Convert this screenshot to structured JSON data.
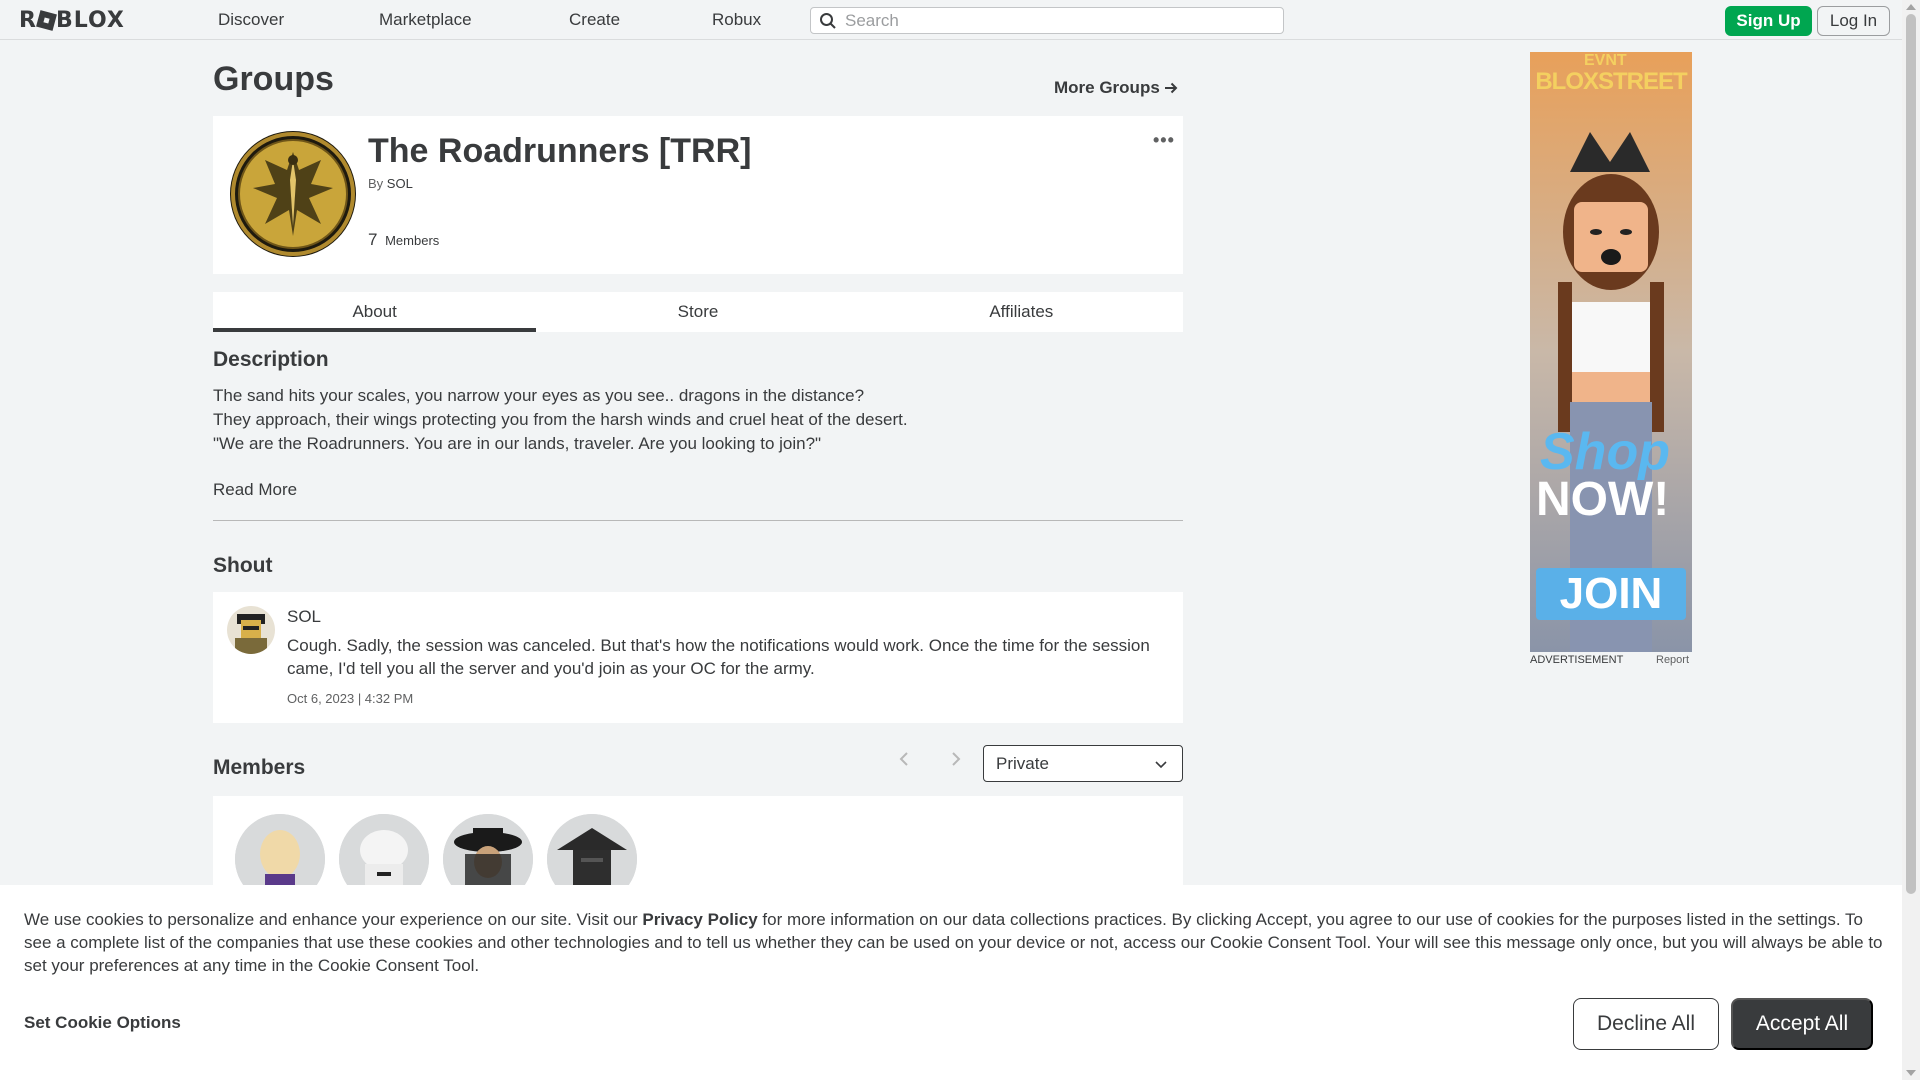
{
  "nav": {
    "logo_text": "ROBLOX",
    "links": [
      "Discover",
      "Marketplace",
      "Create",
      "Robux"
    ],
    "search_placeholder": "Search",
    "signup_label": "Sign Up",
    "login_label": "Log In"
  },
  "page": {
    "title": "Groups",
    "more_groups": "More Groups"
  },
  "group": {
    "name": "The Roadrunners [TRR]",
    "by_prefix": "By",
    "owner": "SOL",
    "member_count": "7",
    "members_label": "Members"
  },
  "tabs": [
    "About",
    "Store",
    "Affiliates"
  ],
  "about": {
    "description_heading": "Description",
    "description_lines": [
      "The sand hits your scales, you narrow your eyes as you see.. dragons in the distance?",
      "They approach, their wings protecting you from the harsh winds and cruel heat of the desert.",
      "\"We are the Roadrunners. You are in our lands, traveler. Are you looking to join?\""
    ],
    "read_more": "Read More",
    "shout_heading": "Shout",
    "shout": {
      "author": "SOL",
      "text": "Cough. Sadly, the session was canceled. But that's how the notifications would work. Once the time for the session came, I'd tell you all the server and you'd join as your OC for the army.",
      "date": "Oct 6, 2023 | 4:32 PM"
    },
    "members_heading": "Members",
    "rank_filter": "Private"
  },
  "ad": {
    "brand_small": "EVNT",
    "brand": "BLOXSTREET",
    "shop": "Shop",
    "now": "NOW!",
    "join": "JOIN",
    "label": "ADVERTISEMENT",
    "report": "Report"
  },
  "cookie": {
    "text_before": "We use cookies to personalize and enhance your experience on our site. Visit our ",
    "policy_link": "Privacy Policy",
    "text_after": " for more information on our data collections practices. By clicking Accept, you agree to our use of cookies for the purposes listed in the settings. To see a complete list of the companies that use these cookies and other technologies and to tell us whether they can be used on your device or not, access our Cookie Consent Tool. Your will see this message only once, but you will always be able to set your preferences at any time in the Cookie Consent Tool.",
    "options_label": "Set Cookie Options",
    "decline_label": "Decline All",
    "accept_label": "Accept All"
  },
  "colors": {
    "background": "#f2f4f5",
    "text": "#393b3d",
    "signup_green": "#00a650",
    "accept_dark": "#393b3d",
    "emblem_gold": "#c9a53a"
  },
  "icons": [
    "search-icon",
    "arrow-right-icon",
    "more-dots-icon",
    "chevron-left-icon",
    "chevron-right-icon",
    "chevron-down-icon"
  ]
}
